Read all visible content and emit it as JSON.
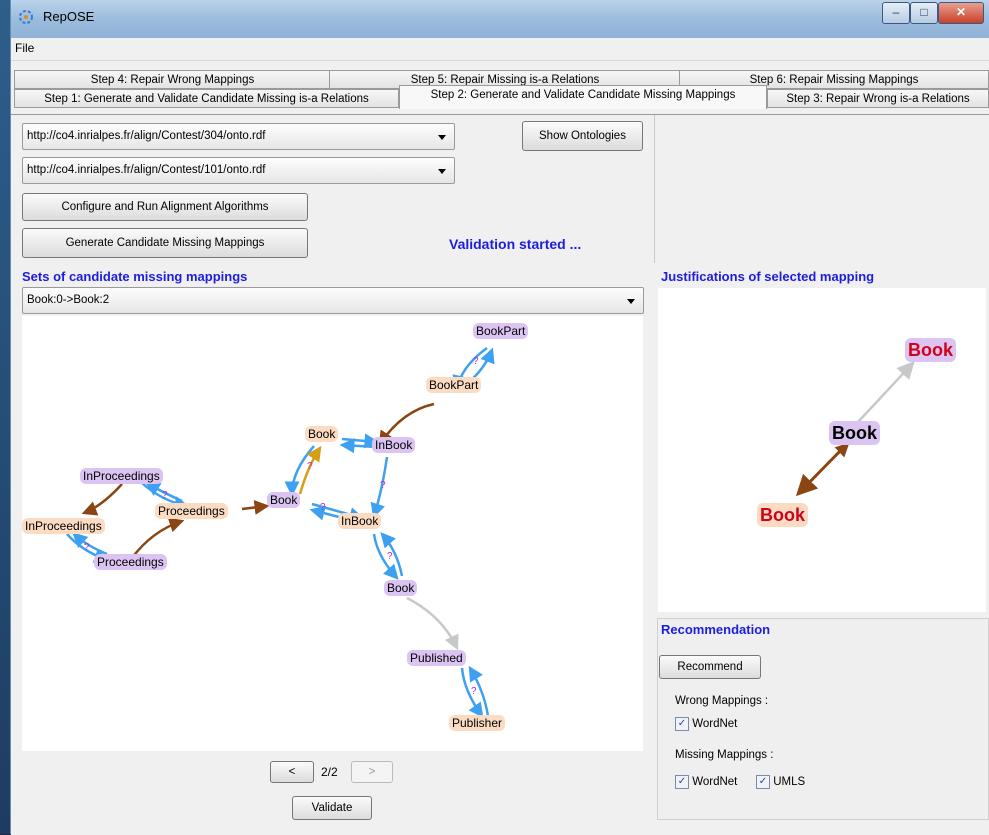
{
  "window": {
    "title": "RepOSE"
  },
  "menu": {
    "file": "File"
  },
  "tabs": {
    "row_top": [
      "Step 4: Repair Wrong Mappings",
      "Step 5: Repair Missing is-a Relations",
      "Step 6: Repair Missing Mappings"
    ],
    "row_bottom": [
      "Step 1: Generate and Validate Candidate Missing is-a Relations",
      "Step 2: Generate and Validate Candidate Missing Mappings",
      "Step 3: Repair Wrong is-a Relations"
    ],
    "active": "Step 2: Generate and Validate Candidate Missing Mappings"
  },
  "controls": {
    "ontology1": "http://co4.inrialpes.fr/align/Contest/304/onto.rdf",
    "ontology2": "http://co4.inrialpes.fr/align/Contest/101/onto.rdf",
    "show_ontologies": "Show Ontologies",
    "configure_run": "Configure and Run Alignment Algorithms",
    "generate_candidates": "Generate Candidate Missing Mappings",
    "status": "Validation started ..."
  },
  "candidates": {
    "title": "Sets of candidate missing mappings",
    "selected_set": "Book:0->Book:2",
    "page": "2/2",
    "prev": "<",
    "next": ">",
    "validate": "Validate",
    "nodes": [
      "BookPart",
      "BookPart",
      "Book",
      "InBook",
      "InProceedings",
      "Book",
      "Proceedings",
      "InProceedings",
      "InBook",
      "Proceedings",
      "Book",
      "Published",
      "Publisher"
    ],
    "edge_marker": "?"
  },
  "justification": {
    "title": "Justifications of selected mapping",
    "nodes": [
      "Book",
      "Book",
      "Book"
    ]
  },
  "recommendation": {
    "title": "Recommendation",
    "button": "Recommend",
    "wrong_label": "Wrong Mappings :",
    "wrong_options": [
      "WordNet"
    ],
    "missing_label": "Missing Mappings :",
    "missing_options": [
      "WordNet",
      "UMLS"
    ]
  },
  "colors": {
    "accent_title": "#1d1de0",
    "node_purple": "#dcc4f2",
    "node_orange": "#fbdcc2",
    "edge_blue": "#3ea0f0",
    "edge_brown": "#8b4513",
    "edge_gold": "#d4a017",
    "edge_gray": "#c8c8c8",
    "just_red": "#d0021b"
  }
}
